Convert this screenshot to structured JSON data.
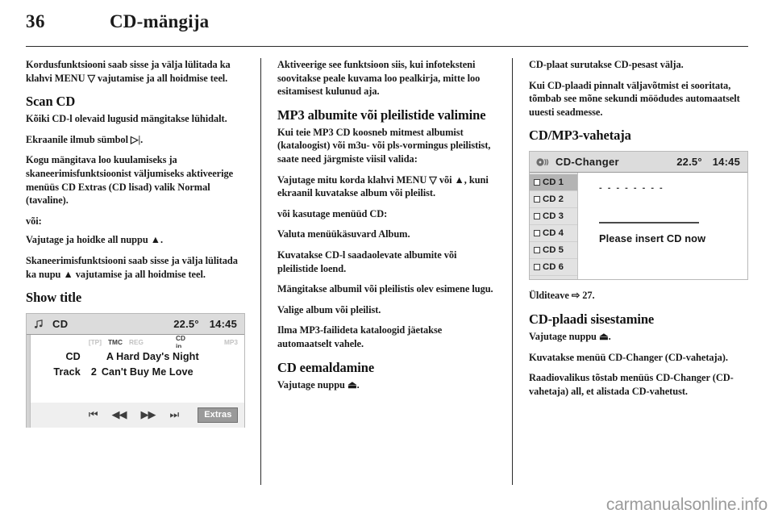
{
  "header": {
    "page_number": "36",
    "chapter_title": "CD-mängija"
  },
  "columns": {
    "left": [
      {
        "type": "p",
        "text": "Kordusfunktsiooni saab sisse ja välja lülitada ka klahvi MENU ▽ vajutamise ja all hoidmise teel."
      },
      {
        "type": "h2",
        "text": "Scan CD"
      },
      {
        "type": "p",
        "text": "Kõiki CD-l olevaid lugusid mängitakse lühidalt."
      },
      {
        "type": "p",
        "text": "Ekraanile ilmub sümbol ▷|."
      },
      {
        "type": "p",
        "text": "Kogu mängitava loo kuulamiseks ja skaneerimisfunktsioonist väljumiseks aktiveerige menüüs CD Extras (CD lisad) valik Normal (tavaline)."
      },
      {
        "type": "p",
        "text": "või:"
      },
      {
        "type": "p",
        "text": "Vajutage ja hoidke all nuppu ▲."
      },
      {
        "type": "p",
        "text": "Skaneerimisfunktsiooni saab sisse ja välja lülitada ka nupu ▲ vajutamise ja all hoidmise teel."
      },
      {
        "type": "h2",
        "text": "Show title"
      }
    ],
    "middle": [
      {
        "type": "p",
        "text": "Aktiveerige see funktsioon siis, kui infoteksteni soovitakse peale kuvama loo pealkirja, mitte loo esitamisest kulunud aja."
      },
      {
        "type": "h2",
        "text": "MP3 albumite või pleilistide valimine"
      },
      {
        "type": "p",
        "text": "Kui teie MP3 CD koosneb mitmest albumist (kataloogist) või m3u- või pls-vormingus pleilistist, saate need järgmiste viisil valida:"
      },
      {
        "type": "p",
        "text": "Vajutage mitu korda klahvi MENU ▽ või ▲, kuni ekraanil kuvatakse album või pleilist."
      },
      {
        "type": "p",
        "text": "või kasutage menüüd CD:"
      },
      {
        "type": "p",
        "text": "Valuta menüükäsuvard Album."
      },
      {
        "type": "p",
        "text": "Kuvatakse CD-l saadaolevate albumite või pleilistide loend."
      },
      {
        "type": "p",
        "text": "Mängitakse albumil või pleilistis olev esimene lugu."
      },
      {
        "type": "p",
        "text": "Valige album või pleilist."
      },
      {
        "type": "p",
        "text": "Ilma MP3-failideta kataloogid jäetakse automaatselt vahele."
      },
      {
        "type": "h2",
        "text": "CD eemaldamine"
      },
      {
        "type": "p",
        "text": "Vajutage nuppu ⏏."
      }
    ],
    "right": [
      {
        "type": "p",
        "text": "CD-plaat surutakse CD-pesast välja."
      },
      {
        "type": "p",
        "text": "Kui CD-plaadi pinnalt väljavõtmist ei sooritata, tõmbab see mõne sekundi möödudes automaatselt uuesti seadmesse."
      },
      {
        "type": "h2",
        "text": "CD/MP3-vahetaja"
      },
      {
        "type": "p",
        "text": "Ülditeave ⇨ 27."
      },
      {
        "type": "h2",
        "text": "CD-plaadi sisestamine"
      },
      {
        "type": "p",
        "text": "Vajutage nuppu ⏏."
      },
      {
        "type": "p",
        "text": "Kuvatakse menüü CD-Changer (CD-vahetaja)."
      },
      {
        "type": "p",
        "text": "Raadiovalikus tõstab menüüs CD-Changer (CD-vahetaja) all, et alistada CD-vahetust."
      }
    ]
  },
  "cd_player_screenshot": {
    "name": "CD player display",
    "titlebar": {
      "icon": "music-note-icon",
      "label": "CD",
      "temperature": "22.5°",
      "clock": "14:45"
    },
    "status_flags": [
      {
        "label": "[TP]",
        "active": true
      },
      {
        "label": "TMC",
        "active": true
      },
      {
        "label": "REG",
        "active": false
      },
      {
        "label": "CD in",
        "active": true
      },
      {
        "label": "MP3",
        "active": false
      }
    ],
    "info": {
      "disc_label": "CD",
      "disc_title": "A Hard Day's Night",
      "track_label": "Track",
      "track_number": "2",
      "track_title": "Can't Buy Me Love"
    },
    "controls": {
      "prev_track": "⏮",
      "rewind": "◀◀",
      "forward": "▶▶",
      "next_track": "⏭",
      "extras_label": "Extras"
    }
  },
  "cd_changer_screenshot": {
    "name": "CD changer display",
    "titlebar": {
      "icon": "disc-icon",
      "label": "CD-Changer",
      "temperature": "22.5°",
      "clock": "14:45"
    },
    "slots": [
      {
        "label": "CD 1",
        "selected": true
      },
      {
        "label": "CD 2",
        "selected": false
      },
      {
        "label": "CD 3",
        "selected": false
      },
      {
        "label": "CD 4",
        "selected": false
      },
      {
        "label": "CD 5",
        "selected": false
      },
      {
        "label": "CD 6",
        "selected": false
      }
    ],
    "dashes": "- - - - - - - -",
    "message": "Please insert CD now"
  },
  "watermark": "carmanualsonline.info"
}
